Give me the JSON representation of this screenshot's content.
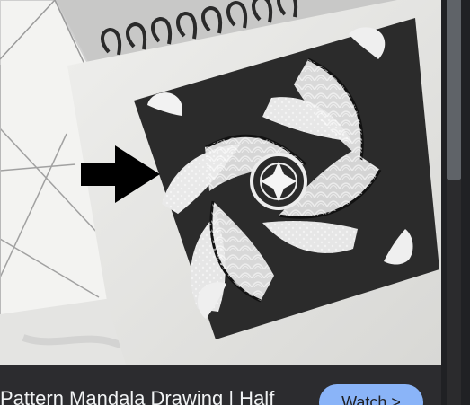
{
  "media": {
    "subject": "pattern mandala drawing thumbnail"
  },
  "caption": {
    "title": "Pattern Mandala Drawing | Half"
  },
  "actions": {
    "watch_label": "Watch >"
  },
  "colors": {
    "background": "#202124",
    "caption_bar": "#2c2c2f",
    "watch_button": "#8ab4f8",
    "scrollbar_thumb": "#5f6368"
  },
  "icons": {
    "arrow": "arrow-icon",
    "chevron": "chevron-right-icon"
  }
}
